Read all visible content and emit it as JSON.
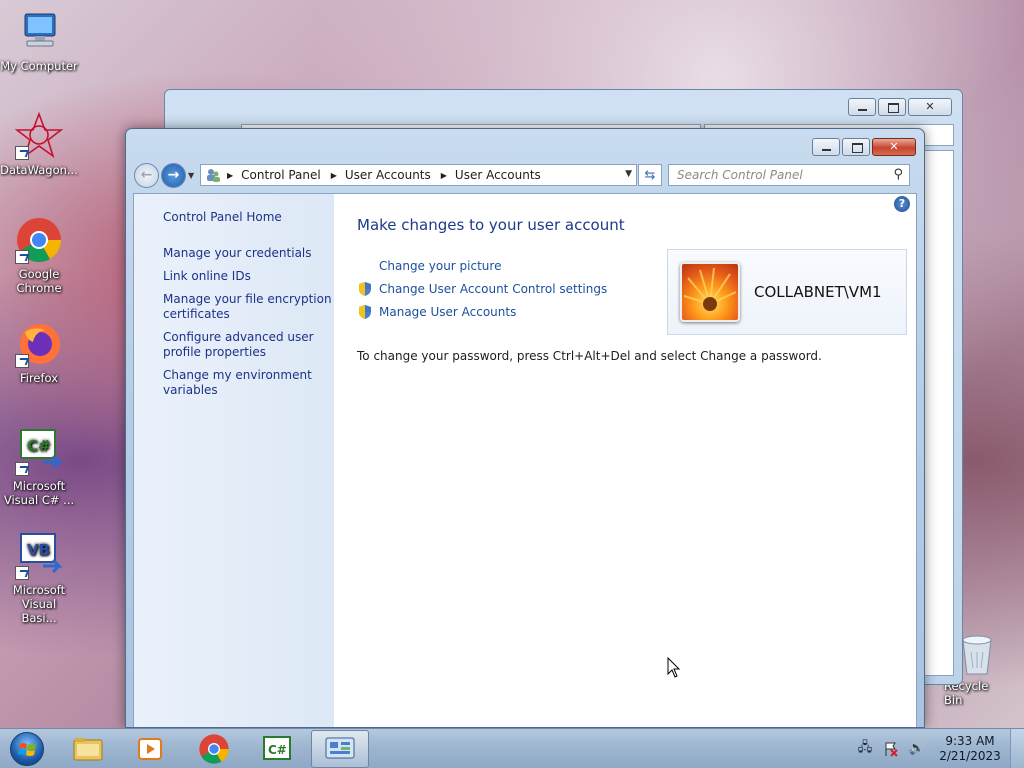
{
  "desktop": {
    "icons": [
      {
        "label": "My Computer"
      },
      {
        "label": "DataWagon..."
      },
      {
        "label": "Google Chrome"
      },
      {
        "label": "Firefox"
      },
      {
        "label": "Microsoft Visual C# ..."
      },
      {
        "label": "Microsoft Visual Basi..."
      }
    ],
    "recycle_bin": "Recycle Bin"
  },
  "window": {
    "breadcrumb": [
      "Control Panel",
      "User Accounts",
      "User Accounts"
    ],
    "search_placeholder": "Search Control Panel",
    "sidebar": {
      "home": "Control Panel Home",
      "links": [
        "Manage your credentials",
        "Link online IDs",
        "Manage your file encryption certificates",
        "Configure advanced user profile properties",
        "Change my environment variables"
      ]
    },
    "main": {
      "heading": "Make changes to your user account",
      "tasks": [
        {
          "label": "Change your picture",
          "shield": false
        },
        {
          "label": "Change User Account Control settings",
          "shield": true
        },
        {
          "label": "Manage User Accounts",
          "shield": true
        }
      ],
      "password_note": "To change your password, press Ctrl+Alt+Del and select Change a password.",
      "user_name": "COLLABNET\\VM1"
    }
  },
  "taskbar": {
    "time": "9:33 AM",
    "date": "2/21/2023",
    "active_button": "control-panel"
  },
  "colors": {
    "link": "#1e3287",
    "heading": "#1e3a8a",
    "task_link": "#1b4f9e"
  }
}
